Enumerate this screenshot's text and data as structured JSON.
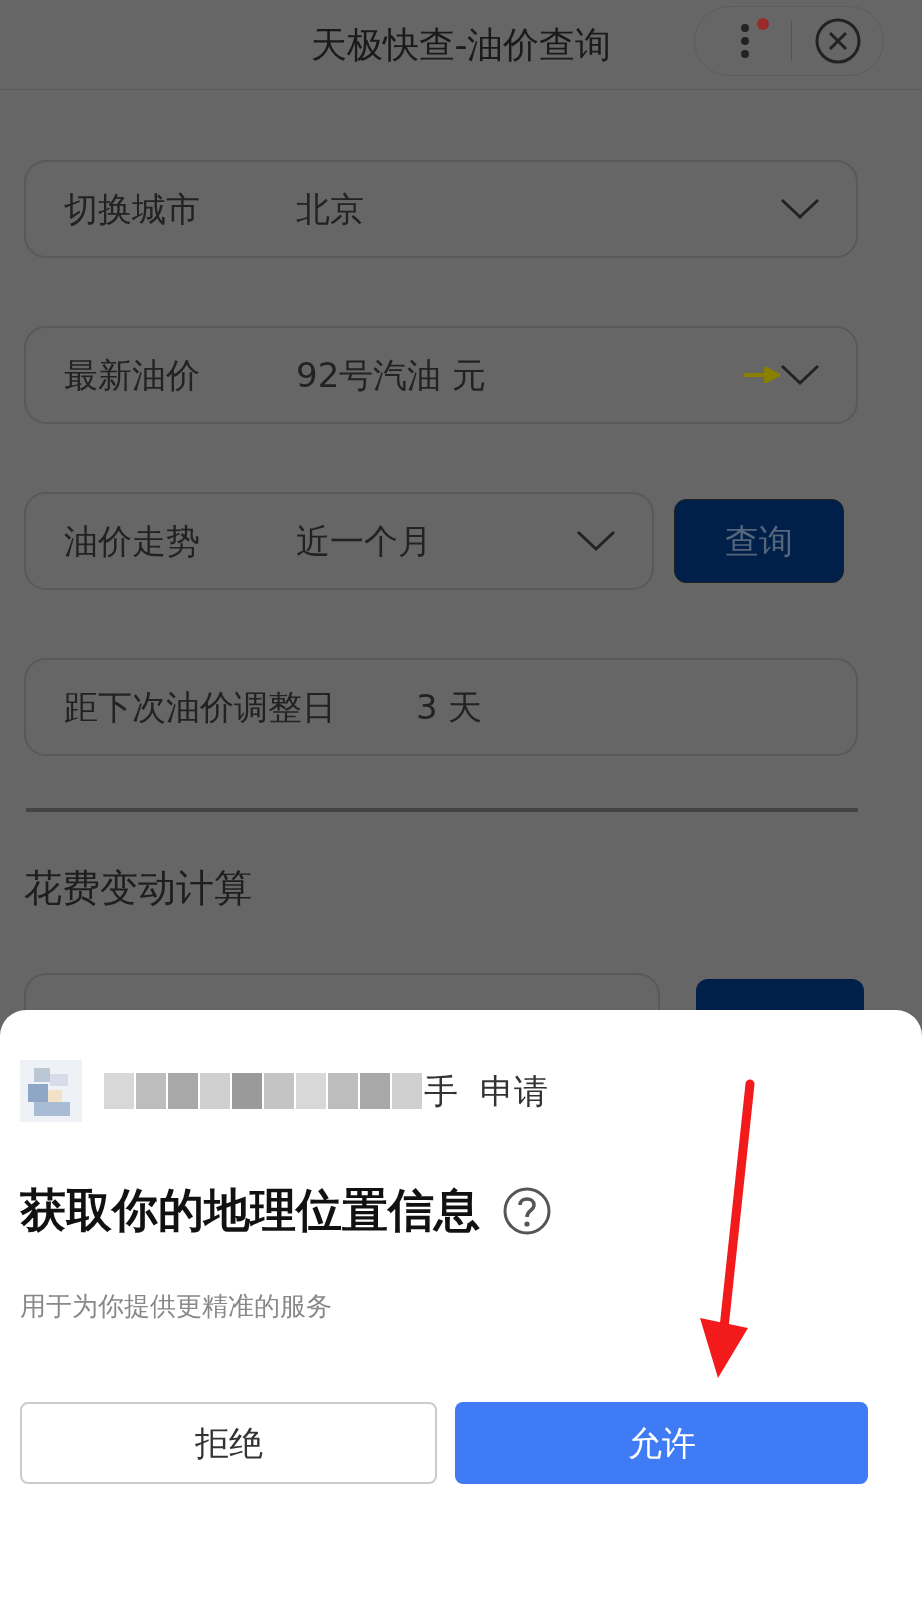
{
  "header": {
    "title": "天极快查-油价查询"
  },
  "fields": [
    {
      "kind": "select",
      "label": "切换城市",
      "value": "北京",
      "pointer": false
    },
    {
      "kind": "select",
      "label": "最新油价",
      "value": "92号汽油 元",
      "pointer": true
    },
    {
      "kind": "select",
      "label": "油价走势",
      "value": "近一个月",
      "pointer": false,
      "button": "查询"
    },
    {
      "kind": "text",
      "label": "距下次油价调整日",
      "value": "3 天"
    }
  ],
  "section_title": "花费变动计算",
  "dialog": {
    "app_name": "手",
    "request": "申请",
    "title": "获取你的地理位置信息",
    "description": "用于为你提供更精准的服务",
    "buttons": [
      {
        "label": "拒绝",
        "kind": "secondary"
      },
      {
        "label": "允许",
        "kind": "primary"
      }
    ]
  }
}
